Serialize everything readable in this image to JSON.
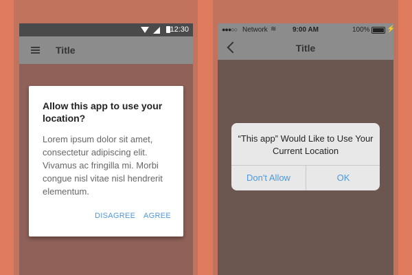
{
  "android": {
    "status": {
      "time": "12:30"
    },
    "toolbar": {
      "title": "Title"
    },
    "dialog": {
      "title": "Allow this app to use your location?",
      "body": "Lorem ipsum dolor sit amet, consectetur adipiscing elit. Vivamus ac fringilla mi. Morbi congue nisl vitae nisl hendrerit elementum.",
      "disagree_label": "DISAGREE",
      "agree_label": "AGREE"
    }
  },
  "ios": {
    "status": {
      "carrier": "Network",
      "time": "9:00 AM",
      "battery": "100%"
    },
    "nav": {
      "title": "Title"
    },
    "alert": {
      "title": "“This app” Would Like to Use Your Current Location",
      "dont_allow_label": "Don't Allow",
      "ok_label": "OK"
    }
  },
  "colors": {
    "background": "#e07b5d",
    "accent": "#4a98e0"
  }
}
